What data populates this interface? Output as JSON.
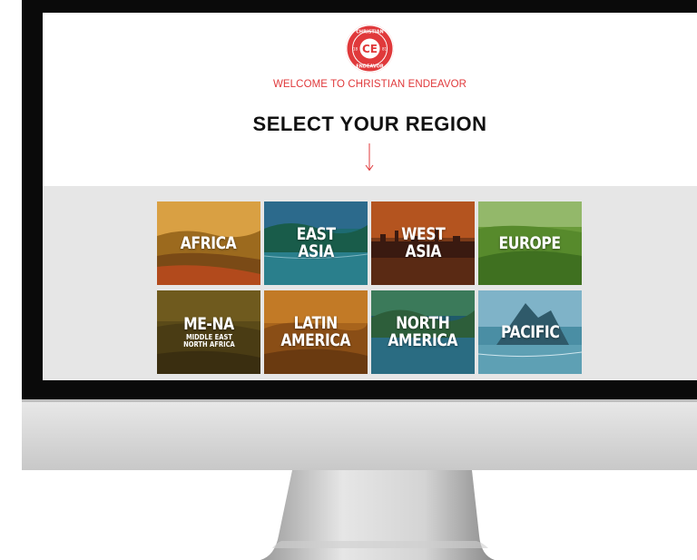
{
  "header": {
    "welcome_text": "WELCOME TO CHRISTIAN ENDEAVOR",
    "heading": "SELECT YOUR REGION",
    "logo": {
      "top_text": "CHRISTIAN",
      "bottom_text": "ENDEAVOR",
      "left_number": "18",
      "right_number": "81",
      "monogram": "CE"
    }
  },
  "regions": [
    {
      "name": "AFRICA",
      "sub": ""
    },
    {
      "name": "EAST\nASIA",
      "sub": ""
    },
    {
      "name": "WEST\nASIA",
      "sub": ""
    },
    {
      "name": "EUROPE",
      "sub": ""
    },
    {
      "name": "ME-NA",
      "sub": "MIDDLE EAST\nNORTH AFRICA"
    },
    {
      "name": "LATIN\nAMERICA",
      "sub": ""
    },
    {
      "name": "NORTH\nAMERICA",
      "sub": ""
    },
    {
      "name": "PACIFIC",
      "sub": ""
    }
  ],
  "colors": {
    "accent": "#e0393b",
    "band": "#e6e6e6"
  }
}
